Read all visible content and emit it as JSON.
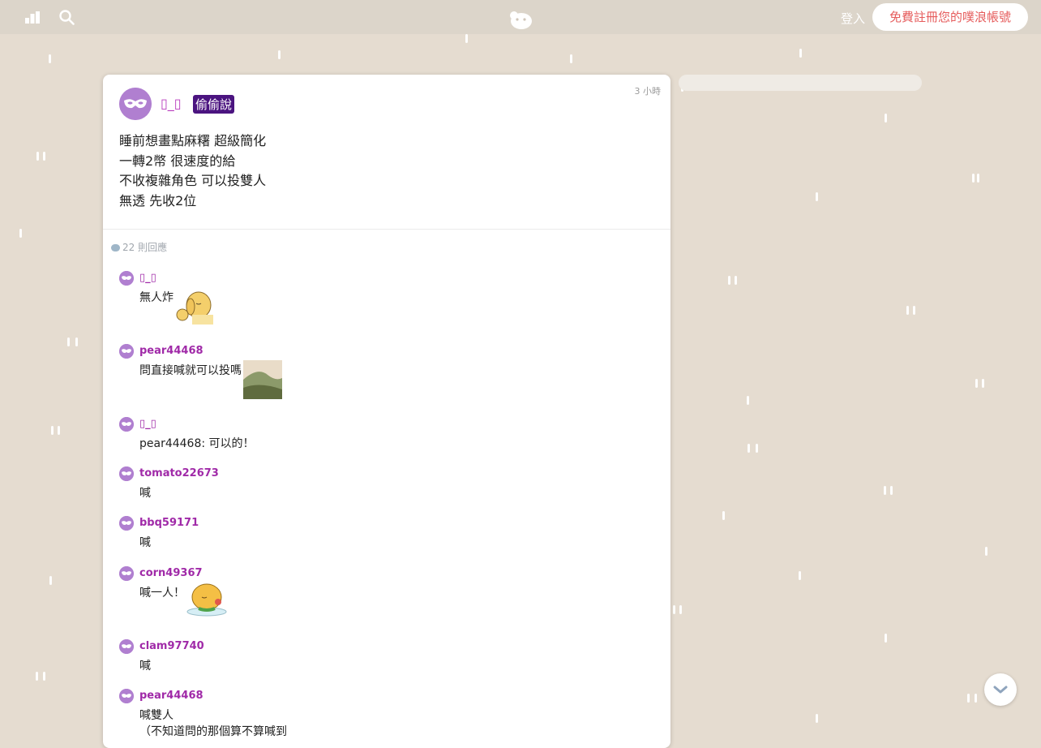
{
  "topbar": {
    "login_label": "登入",
    "signup_label": "免費註冊您的噗浪帳號",
    "icons": [
      "stats-icon",
      "search-icon",
      "plurk-logo-icon"
    ]
  },
  "post": {
    "username": "▯_▯",
    "badge": "偷偷說",
    "time": "3 小時",
    "lines": [
      "睡前想畫點麻糬 超級簡化",
      "一轉2幣 很速度的給",
      "不收複雜角色 可以投雙人",
      "無透 先收2位"
    ],
    "reply_count": "22 則回應"
  },
  "replies": [
    {
      "name": "▯_▯",
      "text": "無人炸",
      "media": "dog-thumbs-up-sticker"
    },
    {
      "name": "pear44468",
      "text": "問直接喊就可以投嗎",
      "media": "landscape-thumbnail"
    },
    {
      "name": "▯_▯",
      "text": "pear44468: 可以的！"
    },
    {
      "name": "tomato22673",
      "text": "喊"
    },
    {
      "name": "bbq59171",
      "text": "喊"
    },
    {
      "name": "corn49367",
      "text": "喊一人！",
      "media": "chick-sticker"
    },
    {
      "name": "clam97740",
      "text": "喊"
    },
    {
      "name": "pear44468",
      "text": "喊雙人",
      "text2": "（不知道問的那個算不算喊到"
    }
  ],
  "colors": {
    "background": "#e5dcd0",
    "topbar": "#dcd5ca",
    "username": "#a02aa8",
    "badge": "#4b1480",
    "signup_text": "#e65d5d",
    "avatar": "#b07fd0"
  }
}
